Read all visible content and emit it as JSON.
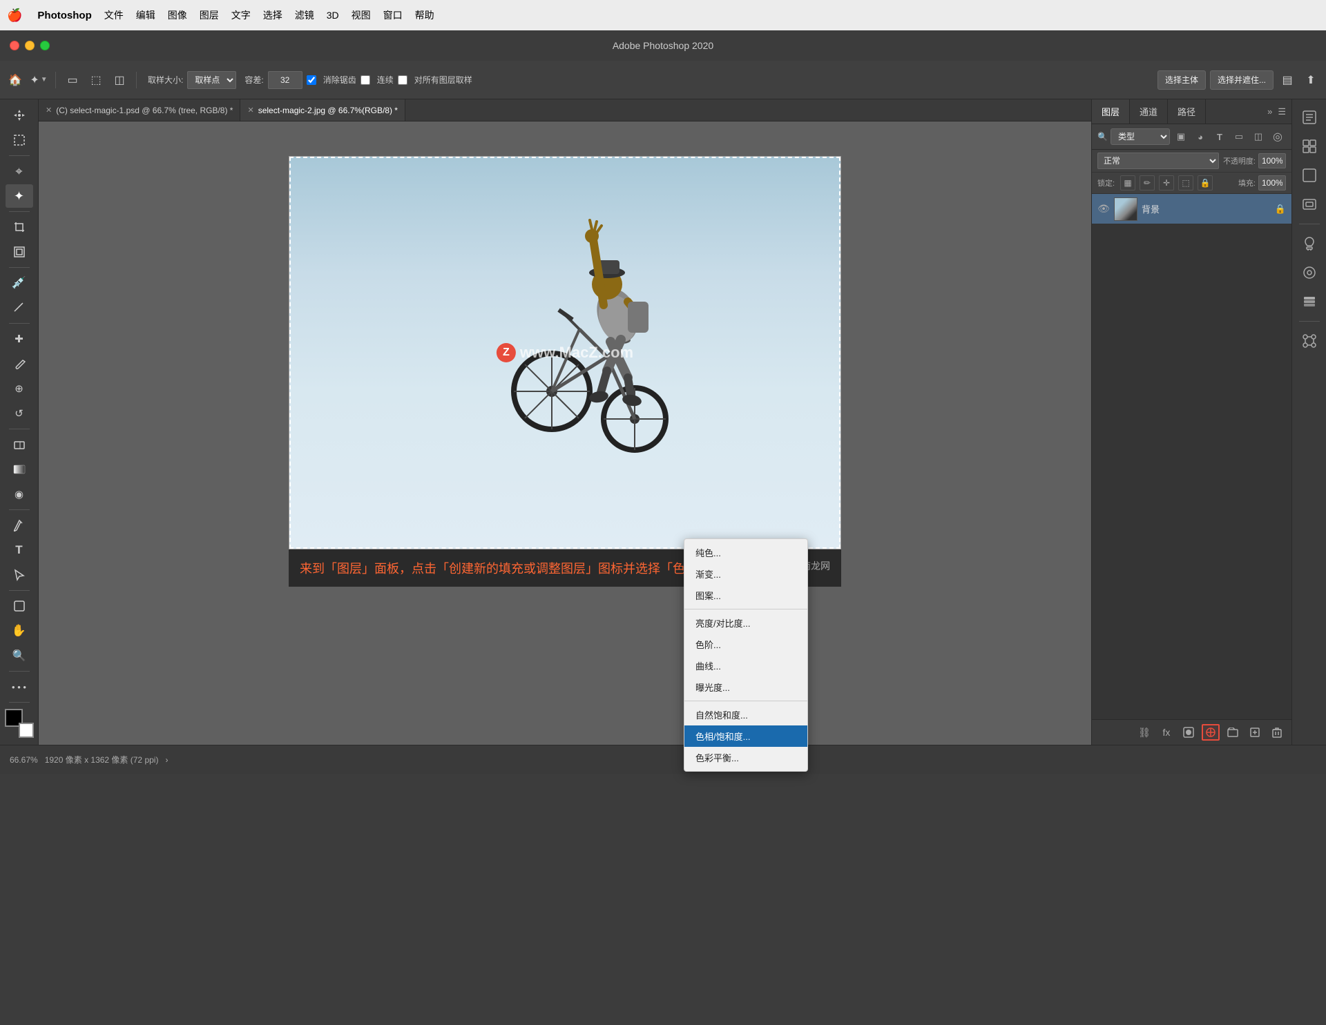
{
  "app": {
    "title": "Adobe Photoshop 2020",
    "name": "Photoshop"
  },
  "menubar": {
    "apple": "🍎",
    "items": [
      "Photoshop",
      "文件",
      "编辑",
      "图像",
      "图层",
      "文字",
      "选择",
      "滤镜",
      "3D",
      "视图",
      "窗口",
      "帮助"
    ]
  },
  "toolbar": {
    "sample_size_label": "取样大小:",
    "sample_size_value": "取样点",
    "tolerance_label": "容差:",
    "tolerance_value": "32",
    "anti_alias_label": "消除锯齿",
    "contiguous_label": "连续",
    "all_layers_label": "对所有图层取样",
    "select_subject": "选择主体",
    "select_refine": "选择并遮住..."
  },
  "tabs": [
    {
      "name": "(C) select-magic-1.psd @ 66.7% (tree, RGB/8) *",
      "active": false,
      "closable": true
    },
    {
      "name": "select-magic-2.jpg @ 66.7%(RGB/8) *",
      "active": true,
      "closable": true
    }
  ],
  "canvas": {
    "watermark": "www.MacZ.com",
    "watermark_z": "Z"
  },
  "caption": {
    "text": "来到「图层」面板，点击「创建新的填充或调整图层」图标并选择「色相/饱和度…」"
  },
  "layers_panel": {
    "tabs": [
      "图层",
      "通道",
      "路径"
    ],
    "active_tab": "图层",
    "search_placeholder": "Q 类型",
    "blend_mode": "正常",
    "opacity_label": "不透明度:",
    "opacity_value": "100%",
    "lock_label": "锁定:",
    "fill_label": "填充:",
    "fill_value": "100%",
    "layers": [
      {
        "name": "背景",
        "visible": true,
        "locked": true,
        "thumb_type": "image"
      }
    ],
    "bottom_buttons": [
      "link",
      "fx",
      "mask",
      "adjustment",
      "folder",
      "new",
      "delete"
    ]
  },
  "adjustment_dropdown": {
    "items": [
      {
        "label": "纯色...",
        "id": "solid-color"
      },
      {
        "label": "渐变...",
        "id": "gradient"
      },
      {
        "label": "图案...",
        "id": "pattern"
      },
      {
        "label": "亮度/对比度...",
        "id": "brightness-contrast"
      },
      {
        "label": "色阶...",
        "id": "levels"
      },
      {
        "label": "曲线...",
        "id": "curves"
      },
      {
        "label": "曝光度...",
        "id": "exposure"
      },
      {
        "label": "自然饱和度...",
        "id": "vibrance"
      },
      {
        "label": "色相/饱和度...",
        "id": "hue-saturation",
        "highlighted": true
      },
      {
        "label": "色彩平衡...",
        "id": "color-balance"
      }
    ]
  },
  "statusbar": {
    "zoom": "66.67%",
    "dimensions": "1920 像素 x 1362 像素 (72 ppi)",
    "arrow": "›"
  },
  "colors": {
    "accent_blue": "#1a6aad",
    "highlight_red": "#e74c3c",
    "caption_orange": "#ff6633",
    "panel_bg": "#3a3a3a",
    "canvas_bg": "#606060",
    "active_tab": "#4a6785"
  }
}
